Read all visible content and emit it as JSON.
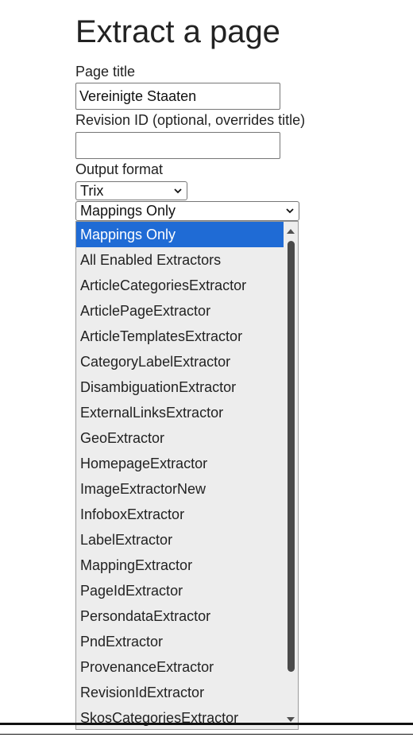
{
  "page": {
    "title": "Extract a page"
  },
  "form": {
    "page_title_label": "Page title",
    "page_title_value": "Vereinigte Staaten",
    "revision_label": "Revision ID (optional, overrides title)",
    "revision_value": "",
    "output_format_label": "Output format",
    "output_format_value": "Trix",
    "extractors_value": "Mappings Only"
  },
  "dropdown": {
    "selected_index": 0,
    "options": [
      "Mappings Only",
      "All Enabled Extractors",
      "ArticleCategoriesExtractor",
      "ArticlePageExtractor",
      "ArticleTemplatesExtractor",
      "CategoryLabelExtractor",
      "DisambiguationExtractor",
      "ExternalLinksExtractor",
      "GeoExtractor",
      "HomepageExtractor",
      "ImageExtractorNew",
      "InfoboxExtractor",
      "LabelExtractor",
      "MappingExtractor",
      "PageIdExtractor",
      "PersondataExtractor",
      "PndExtractor",
      "ProvenanceExtractor",
      "RevisionIdExtractor",
      "SkosCategoriesExtractor"
    ]
  },
  "colors": {
    "selected_option_bg": "#1f6bd5",
    "dropdown_bg": "#ededed"
  },
  "icons": {
    "select_arrow": "chevron-down-icon",
    "scroll_up": "triangle-up-icon",
    "scroll_down": "triangle-down-icon"
  }
}
